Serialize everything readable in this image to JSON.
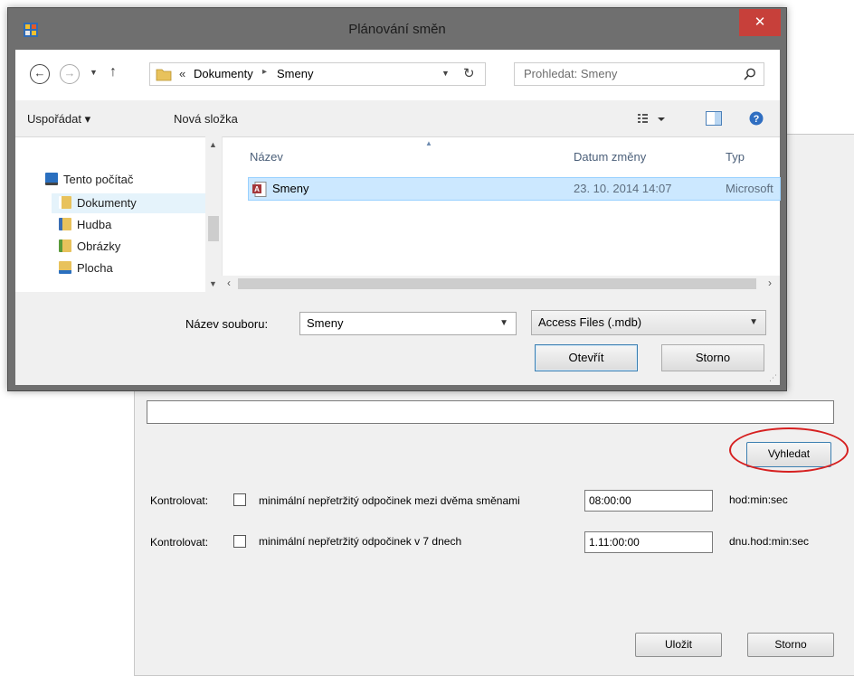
{
  "dialog": {
    "title": "Plánování směn",
    "close_glyph": "✕",
    "address": {
      "overflow": "«",
      "crumbs": [
        "Dokumenty",
        "Smeny"
      ],
      "separator": "▸"
    },
    "search_placeholder": "Prohledat: Smeny",
    "toolbar": {
      "organize_label": "Uspořádat ▾",
      "new_folder_label": "Nová složka"
    },
    "nav": [
      {
        "label": "Tento počítač",
        "icon": "computer-icon"
      },
      {
        "label": "Dokumenty",
        "icon": "documents-folder-icon",
        "selected": true
      },
      {
        "label": "Hudba",
        "icon": "music-folder-icon"
      },
      {
        "label": "Obrázky",
        "icon": "pictures-folder-icon"
      },
      {
        "label": "Plocha",
        "icon": "desktop-folder-icon"
      }
    ],
    "columns": [
      "Název",
      "Datum změny",
      "Typ"
    ],
    "files": [
      {
        "name": "Smeny",
        "date": "23. 10. 2014 14:07",
        "type": "Microsoft",
        "icon": "access-file-icon"
      }
    ],
    "filename_label": "Název souboru:",
    "filename_value": "Smeny",
    "filetype_value": "Access Files (.mdb)",
    "open_label": "Otevřít",
    "cancel_label": "Storno"
  },
  "settings": {
    "path_value": "",
    "search_button": "Vyhledat",
    "rules": [
      {
        "check_label": "Kontrolovat:",
        "checked": false,
        "description": "minimální nepřetržitý odpočinek mezi dvěma směnami",
        "value": "08:00:00",
        "unit": "hod:min:sec"
      },
      {
        "check_label": "Kontrolovat:",
        "checked": false,
        "description": "minimální nepřetržitý odpočinek v 7 dnech",
        "value": "1.11:00:00",
        "unit": "dnu.hod:min:sec"
      }
    ],
    "save_button": "Uložit",
    "cancel_button": "Storno"
  },
  "colors": {
    "selection": "#cce8ff",
    "close": "#c7403a",
    "highlight_ring": "#d62020"
  }
}
